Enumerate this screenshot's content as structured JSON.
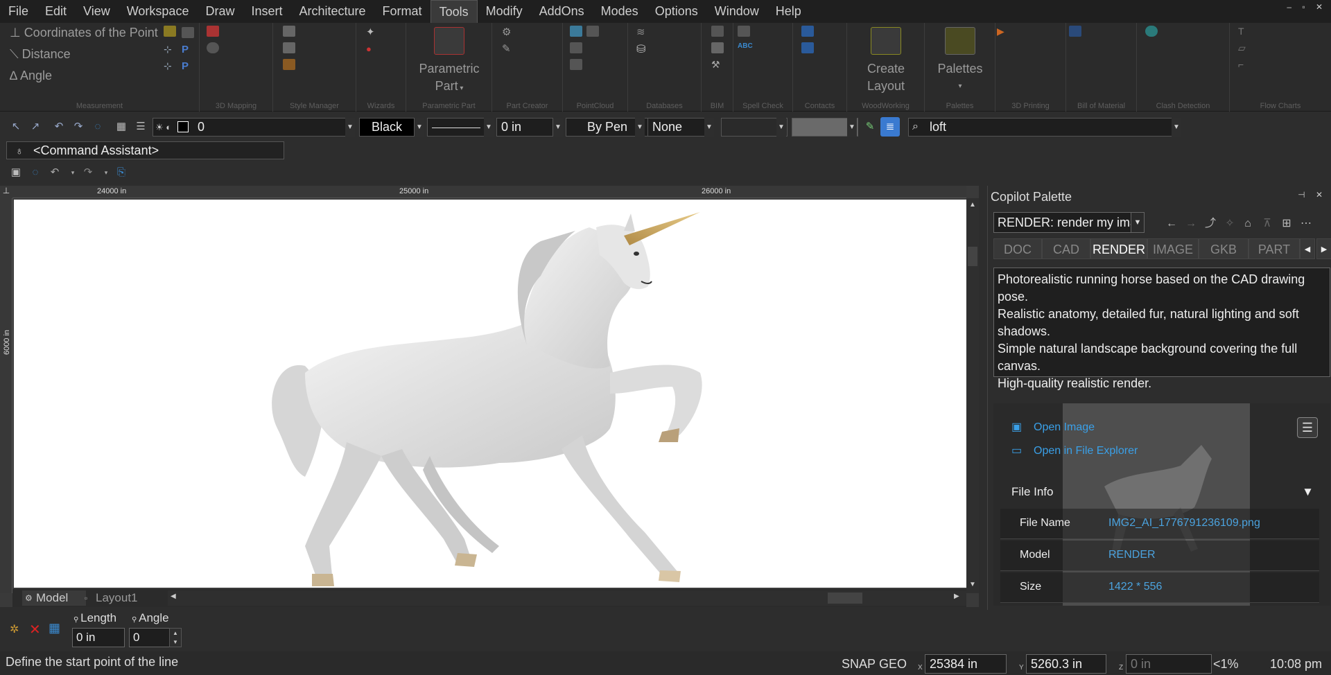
{
  "menubar": {
    "items": [
      "File",
      "Edit",
      "View",
      "Workspace",
      "Draw",
      "Insert",
      "Architecture",
      "Format",
      "Tools",
      "Modify",
      "AddOns",
      "Modes",
      "Options",
      "Window",
      "Help"
    ],
    "active": "Tools"
  },
  "ribbon": {
    "measurement": {
      "items": [
        "Coordinates of the Point",
        "Distance",
        "Angle"
      ],
      "group_label": "Measurement"
    },
    "groups": [
      "3D Mapping",
      "Style Manager",
      "Wizards",
      "Parametric Part",
      "Part Creator",
      "PointCloud",
      "Databases",
      "BIM",
      "Spell Check",
      "Contacts",
      "WoodWorking",
      "Palettes",
      "3D Printing",
      "Bill of Material",
      "Clash Detection",
      "Flow Charts"
    ],
    "parametric_part_label_1": "Parametric",
    "parametric_part_label_2": "Part",
    "create_layout_label_1": "Create",
    "create_layout_label_2": "Layout",
    "palettes_label": "Palettes"
  },
  "toolbar": {
    "layer_value": "0",
    "color_value": "Black",
    "thickness_value": "0 in",
    "pen_value": "By Pen",
    "fill_value": "None",
    "search_value": "loft"
  },
  "command_assistant": "<Command Assistant>",
  "ruler": {
    "h_labels": [
      "24000 in",
      "25000 in",
      "26000 in"
    ],
    "v_label": "6000 in"
  },
  "tabs": [
    "Model",
    "Layout1"
  ],
  "copilot": {
    "title": "Copilot Palette",
    "select_value": "RENDER: render my ima",
    "tabs": [
      "DOC",
      "CAD",
      "RENDER",
      "IMAGE",
      "GKB",
      "PART"
    ],
    "active_tab": "RENDER",
    "prompt_lines": [
      "Photorealistic running horse based on the CAD drawing pose.",
      "Realistic anatomy, detailed fur, natural lighting and soft shadows.",
      "Simple natural landscape background covering the full canvas.",
      "High-quality realistic render."
    ],
    "open_image": "Open Image",
    "open_explorer": "Open in File Explorer",
    "file_info_label": "File Info",
    "file_info": [
      {
        "key": "File Name",
        "value": "IMG2_AI_1776791236109.png"
      },
      {
        "key": "Model",
        "value": "RENDER"
      },
      {
        "key": "Size",
        "value": "1422 * 556"
      }
    ]
  },
  "bottom": {
    "length_label": "Length",
    "angle_label": "Angle",
    "length_value": "0 in",
    "angle_value": "0"
  },
  "status": {
    "message": "Define the start point of the line",
    "snap": "SNAP",
    "geo": "GEO",
    "x_value": "25384 in",
    "y_value": "5260.3 in",
    "z_value": "0 in",
    "x_label": "X",
    "y_label": "Y",
    "z_label": "Z",
    "zoom": "<1%",
    "time": "10:08 pm"
  },
  "colors": {
    "accent_blue": "#3aa0e8",
    "background": "#2d2d2d",
    "canvas": "#ffffff"
  }
}
